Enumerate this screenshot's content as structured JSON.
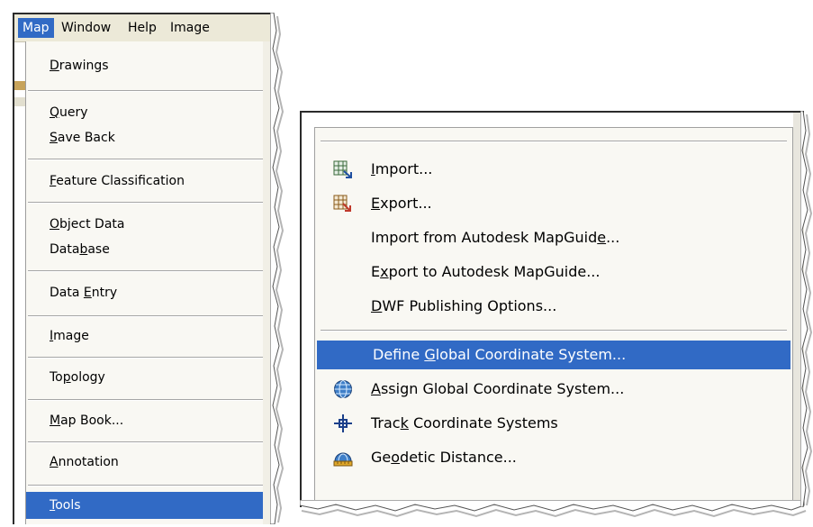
{
  "menubar": {
    "items": [
      {
        "label": "Map",
        "active": true
      },
      {
        "label": "Window",
        "active": false
      },
      {
        "label": "Help",
        "active": false
      },
      {
        "label": "Image",
        "active": false
      }
    ]
  },
  "map_menu": {
    "items": [
      {
        "label": "Drawings",
        "mnemonic_index": 0,
        "submenu": true
      },
      {
        "label": "Query",
        "mnemonic_index": 0,
        "submenu": true
      },
      {
        "label": "Save Back",
        "mnemonic_index": 0,
        "submenu": true
      },
      {
        "label": "Feature Classification",
        "mnemonic_index": 0,
        "submenu": true
      },
      {
        "label": "Object Data",
        "mnemonic_index": 0,
        "submenu": true
      },
      {
        "label": "Database",
        "mnemonic_index": 4,
        "submenu": true
      },
      {
        "label": "Data Entry",
        "mnemonic_index": 5,
        "submenu": true
      },
      {
        "label": "Image",
        "mnemonic_index": 0,
        "submenu": true
      },
      {
        "label": "Topology",
        "mnemonic_index": 2,
        "submenu": true
      },
      {
        "label": "Map Book...",
        "mnemonic_index": 0,
        "submenu": false
      },
      {
        "label": "Annotation",
        "mnemonic_index": 0,
        "submenu": true
      },
      {
        "label": "Tools",
        "mnemonic_index": 0,
        "submenu": true,
        "highlighted": true
      }
    ]
  },
  "tools_submenu": {
    "items": [
      {
        "label": "Import...",
        "mnemonic_index": 0,
        "icon": "import-icon"
      },
      {
        "label": "Export...",
        "mnemonic_index": 0,
        "icon": "export-icon"
      },
      {
        "label": "Import from Autodesk MapGuide...",
        "mnemonic_index": 28,
        "icon": null
      },
      {
        "label": "Export to Autodesk MapGuide...",
        "mnemonic_index": 1,
        "icon": null
      },
      {
        "label": "DWF Publishing Options...",
        "mnemonic_index": 0,
        "icon": null
      },
      {
        "label": "Define Global Coordinate System...",
        "mnemonic_index": 7,
        "icon": null,
        "highlighted": true
      },
      {
        "label": "Assign Global Coordinate System...",
        "mnemonic_index": 0,
        "icon": "globe-icon"
      },
      {
        "label": "Track Coordinate Systems",
        "mnemonic_index": 4,
        "icon": "crosshair-icon"
      },
      {
        "label": "Geodetic Distance...",
        "mnemonic_index": 2,
        "icon": "geodetic-distance-icon"
      }
    ]
  },
  "colors": {
    "highlight": "#316ac5",
    "menu_background": "#f9f8f3",
    "menubar_background": "#ece9d8"
  }
}
